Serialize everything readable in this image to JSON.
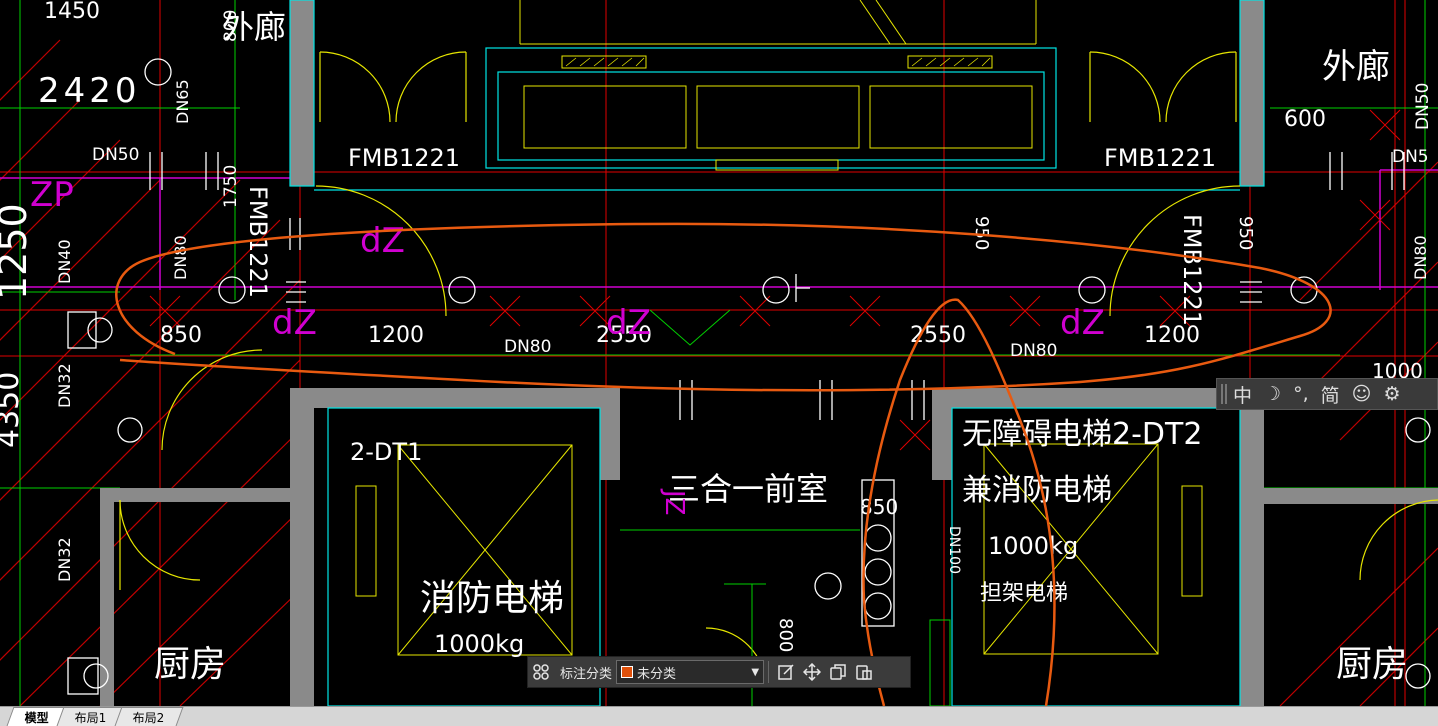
{
  "drawing": {
    "labels": {
      "dim_1450": "1450",
      "dim_2420": "2420",
      "corridor_left": "外廊",
      "corridor_right": "外廊",
      "dn65": "DN65",
      "dn50_left": "DN50",
      "dn50_right": "DN50",
      "dn50_right2": "DN5",
      "zp": "ZP",
      "dim_1250": "1250",
      "dn40": "DN40",
      "dn80_left": "DN80",
      "dn80_right": "DN80",
      "dn32_a": "DN32",
      "dn32_b": "DN32",
      "dim_1750": "1750",
      "fmb_left_top": "FMB1221",
      "fmb_right_top": "FMB1221",
      "fmb_left_vert": "FMB1221",
      "fmb_right_vert": "FMB1221",
      "dim_800": "800",
      "dim_600": "600",
      "dim_950_a": "950",
      "dim_950_b": "950",
      "dim_850_a": "850",
      "dim_1200_a": "1200",
      "dim_2550_a": "2550",
      "dim_2550_b": "2550",
      "dim_1200_b": "1200",
      "dn80_mid_a": "DN80",
      "dn80_mid_b": "DN80",
      "dim_1000": "1000",
      "dim_4350": "4350",
      "dt1": "2-DT1",
      "dt2_title": "无障碍电梯2-DT2",
      "dt2_sub": "兼消防电梯",
      "anteroom": "三合一前室",
      "fire_elevator": "消防电梯",
      "load_left": "1000kg",
      "load_right": "1000kg",
      "stretcher": "担架电梯",
      "kitchen_left": "厨房",
      "kitchen_right": "厨房",
      "dim_850_b": "850",
      "dim_800_b": "800",
      "dn100": "DN100",
      "jz": "JZ",
      "dz_a": "dZ",
      "dz_b": "dZ",
      "dz_c": "dZ",
      "dz_d": "dZ"
    },
    "colors": {
      "wall": "#8a8a8a",
      "cyan": "#00e5e5",
      "yellow": "#e6e600",
      "red": "#e00000",
      "magenta": "#d000d0",
      "green": "#00d000",
      "white": "#ffffff",
      "markup": "#e85a10"
    }
  },
  "ime": {
    "items": [
      "中",
      "☽",
      "°,",
      "简",
      "☺",
      "⚙"
    ]
  },
  "annotation_toolbar": {
    "category_label": "标注分类",
    "category_value": "未分类",
    "category_color": "#e0500a"
  },
  "tabs": [
    {
      "label": "模型",
      "active": true
    },
    {
      "label": "布局1",
      "active": false
    },
    {
      "label": "布局2",
      "active": false
    }
  ]
}
